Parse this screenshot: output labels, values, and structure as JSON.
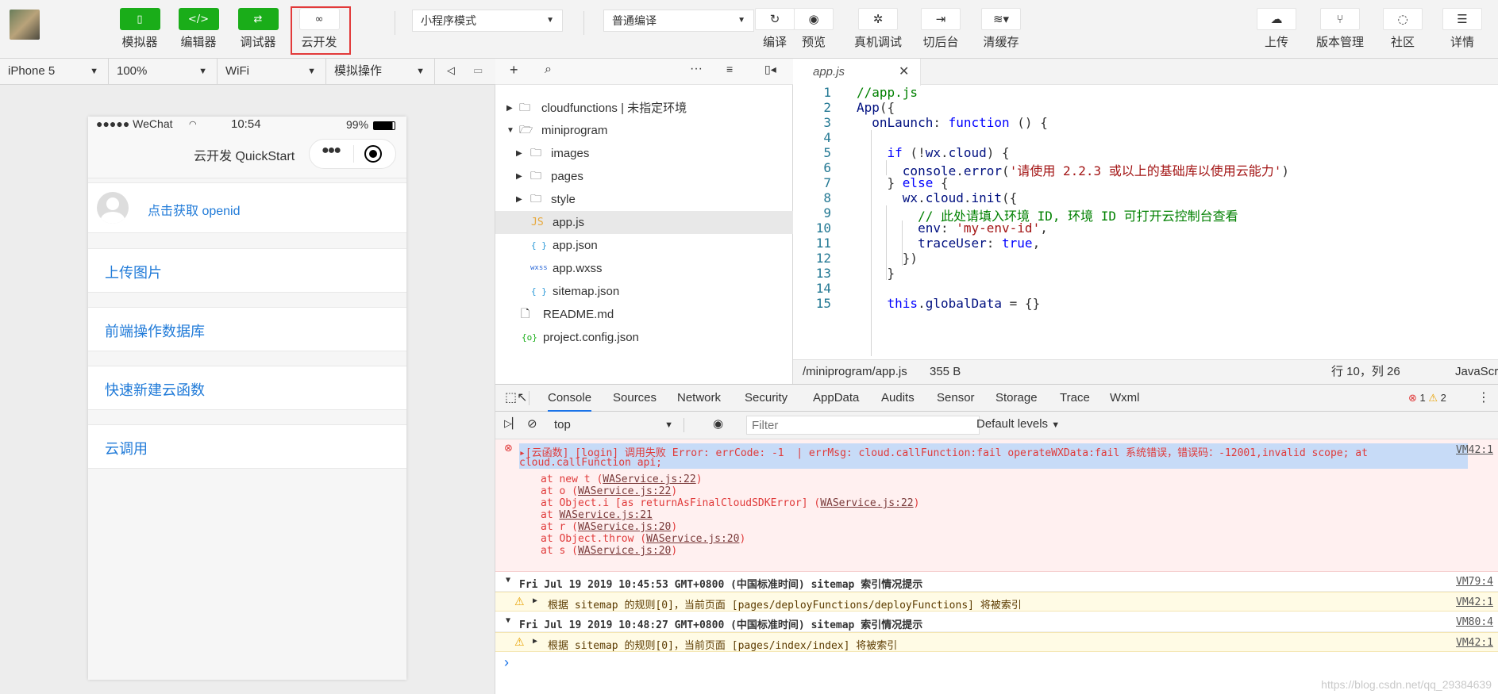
{
  "toolbar": {
    "left_buttons": [
      {
        "label": "模拟器",
        "icon": "phone-icon"
      },
      {
        "label": "编辑器",
        "icon": "code-icon"
      },
      {
        "label": "调试器",
        "icon": "debug-icon"
      },
      {
        "label": "云开发",
        "icon": "cloud-link-icon"
      }
    ],
    "mode_select": "小程序模式",
    "compile_select": "普通编译",
    "tools": [
      {
        "label": "编译",
        "icon": "refresh-icon"
      },
      {
        "label": "预览",
        "icon": "eye-icon"
      },
      {
        "label": "真机调试",
        "icon": "bug-icon"
      },
      {
        "label": "切后台",
        "icon": "switch-icon"
      },
      {
        "label": "清缓存",
        "icon": "layers-icon"
      }
    ],
    "right_tools": [
      {
        "label": "上传",
        "icon": "upload-icon"
      },
      {
        "label": "版本管理",
        "icon": "branch-icon"
      },
      {
        "label": "社区",
        "icon": "chat-icon"
      },
      {
        "label": "详情",
        "icon": "menu-icon"
      }
    ]
  },
  "subbar": {
    "device": "iPhone 5",
    "zoom": "100%",
    "network": "WiFi",
    "operation": "模拟操作"
  },
  "phone": {
    "carrier": "●●●●● WeChat",
    "time": "10:54",
    "battery": "99%",
    "nav_title": "云开发 QuickStart",
    "openid_link": "点击获取 openid",
    "cells": [
      "上传图片",
      "前端操作数据库",
      "快速新建云函数",
      "云调用"
    ]
  },
  "tree": {
    "items": [
      {
        "name": "cloudfunctions | 未指定环境",
        "type": "folder-cloud",
        "depth": 0,
        "expanded": false
      },
      {
        "name": "miniprogram",
        "type": "folder",
        "depth": 0,
        "expanded": true
      },
      {
        "name": "images",
        "type": "folder",
        "depth": 1,
        "expanded": false
      },
      {
        "name": "pages",
        "type": "folder",
        "depth": 1,
        "expanded": false
      },
      {
        "name": "style",
        "type": "folder",
        "depth": 1,
        "expanded": false
      },
      {
        "name": "app.js",
        "type": "js",
        "depth": 1,
        "selected": true
      },
      {
        "name": "app.json",
        "type": "json",
        "depth": 1
      },
      {
        "name": "app.wxss",
        "type": "wxss",
        "depth": 1
      },
      {
        "name": "sitemap.json",
        "type": "json",
        "depth": 1
      },
      {
        "name": "README.md",
        "type": "file",
        "depth": 0
      },
      {
        "name": "project.config.json",
        "type": "config",
        "depth": 0
      }
    ]
  },
  "editor": {
    "tab": "app.js",
    "status_path": "/miniprogram/app.js",
    "status_size": "355 B",
    "status_pos": "行 10，列 26",
    "status_lang": "JavaScript",
    "line_numbers": [
      "1",
      "2",
      "3",
      "4",
      "5",
      "6",
      "7",
      "8",
      "9",
      "10",
      "11",
      "12",
      "13",
      "14",
      "15"
    ]
  },
  "console": {
    "tabs": [
      "Console",
      "Sources",
      "Network",
      "Security",
      "AppData",
      "Audits",
      "Sensor",
      "Storage",
      "Trace",
      "Wxml"
    ],
    "error_count": "1",
    "warning_count": "2",
    "context": "top",
    "filter_placeholder": "Filter",
    "levels": "Default levels",
    "error_head": "▸[云函数] [login] 调用失败 Error: errCode: -1  | errMsg: cloud.callFunction:fail operateWXData:fail 系统错误，错误码：-12001,invalid scope; at",
    "error_head2": "cloud.callFunction api;",
    "error_source": "VM42:1",
    "stack": [
      {
        "pre": "at new t (",
        "link": "WAService.js:22",
        "post": ")"
      },
      {
        "pre": "at o (",
        "link": "WAService.js:22",
        "post": ")"
      },
      {
        "pre": "at Object.i [as returnAsFinalCloudSDKError] (",
        "link": "WAService.js:22",
        "post": ")"
      },
      {
        "pre": "at ",
        "link": "WAService.js:21",
        "post": ""
      },
      {
        "pre": "at r (",
        "link": "WAService.js:20",
        "post": ")"
      },
      {
        "pre": "at Object.throw (",
        "link": "WAService.js:20",
        "post": ")"
      },
      {
        "pre": "at s (",
        "link": "WAService.js:20",
        "post": ")"
      }
    ],
    "groups": [
      {
        "head": "Fri Jul 19 2019 10:45:53 GMT+0800 (中国标准时间) sitemap 索引情况提示",
        "src": "VM79:4",
        "warn": "根据 sitemap 的规则[0]，当前页面 [pages/deployFunctions/deployFunctions] 将被索引",
        "wsrc": "VM42:1"
      },
      {
        "head": "Fri Jul 19 2019 10:48:27 GMT+0800 (中国标准时间) sitemap 索引情况提示",
        "src": "VM80:4",
        "warn": "根据 sitemap 的规则[0]，当前页面 [pages/index/index] 将被索引",
        "wsrc": "VM42:1"
      }
    ],
    "prompt": "›"
  },
  "watermark": "https://blog.csdn.net/qq_29384639",
  "colors": {
    "brand_green": "#1aad19",
    "link_blue": "#1f7ad8",
    "error_red": "#e03a3a",
    "highlight_red": "#e23a3a"
  }
}
